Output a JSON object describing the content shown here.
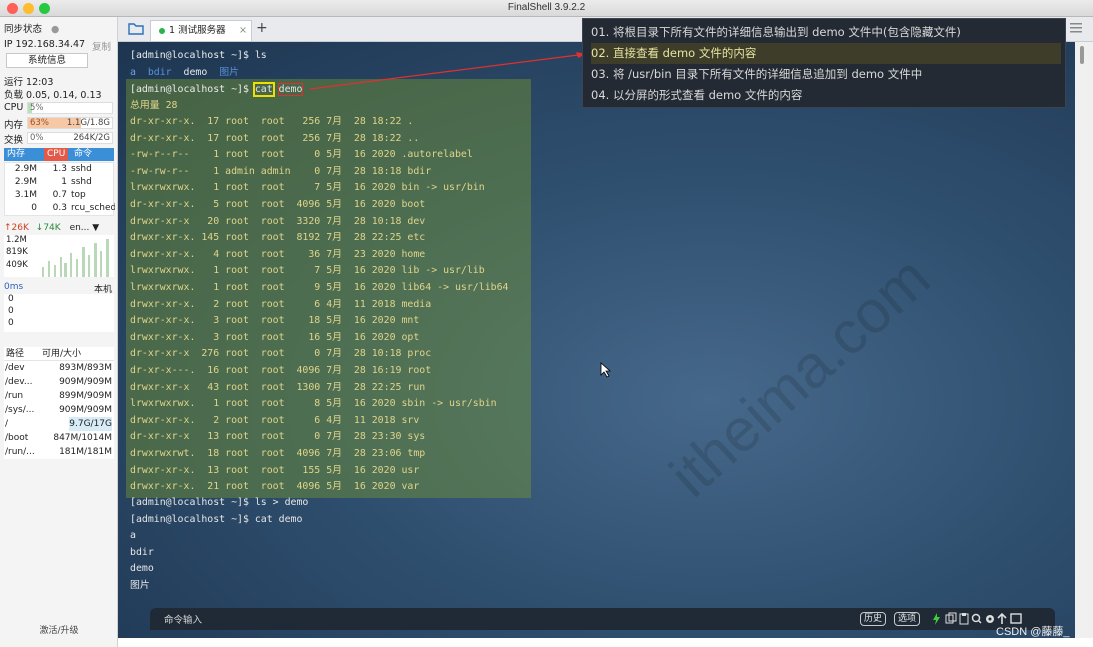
{
  "window": {
    "title": "FinalShell 3.9.2.2"
  },
  "sidebar": {
    "sync_status": "同步状态",
    "ip": "IP 192.168.34.47",
    "copy": "复制",
    "sysinfo_button": "系统信息",
    "uptime": "运行 12:03",
    "load": "负载 0.05, 0.14, 0.13",
    "cpu": {
      "label": "CPU",
      "value": "5%",
      "fraction": 0.05
    },
    "mem": {
      "label": "内存",
      "percent": "63%",
      "value": "1.1G/1.8G",
      "fraction": 0.63
    },
    "swap": {
      "label": "交换",
      "percent": "0%",
      "value": "264K/2G",
      "fraction": 0.0
    },
    "proc_headers": [
      "内存",
      "CPU",
      "命令"
    ],
    "processes": [
      {
        "mem": "2.9M",
        "cpu": "1.3",
        "cmd": "sshd"
      },
      {
        "mem": "2.9M",
        "cpu": "1",
        "cmd": "sshd"
      },
      {
        "mem": "3.1M",
        "cpu": "0.7",
        "cmd": "top"
      },
      {
        "mem": "0",
        "cpu": "0.3",
        "cmd": "rcu_sched"
      }
    ],
    "net": {
      "up": "↑26K",
      "down": "↓74K",
      "iface": "en...",
      "scale": [
        "1.2M",
        "819K",
        "409K"
      ]
    },
    "latency": {
      "value": "0ms",
      "host": "本机",
      "scale": [
        "0",
        "0",
        "0"
      ]
    },
    "disk_headers": [
      "路径",
      "可用/大小"
    ],
    "disks": [
      {
        "path": "/dev",
        "size": "893M/893M"
      },
      {
        "path": "/dev...",
        "size": "909M/909M"
      },
      {
        "path": "/run",
        "size": "899M/909M"
      },
      {
        "path": "/sys/...",
        "size": "909M/909M"
      },
      {
        "path": "/",
        "size": "9.7G/17G"
      },
      {
        "path": "/boot",
        "size": "847M/1014M"
      },
      {
        "path": "/run/...",
        "size": "181M/181M"
      }
    ],
    "upgrade": "激活/升级"
  },
  "tabs": [
    {
      "label": "1 测试服务器",
      "close": "×"
    }
  ],
  "tab_add": "+",
  "terminal": {
    "prompt1": "[admin@localhost ~]$ ",
    "cmd1": "ls",
    "ls_items": [
      "a",
      "bdir",
      "demo",
      "图片"
    ],
    "prompt2": "[admin@localhost ~]$ ",
    "cmd2_word": "cat",
    "cmd2_arg": "demo",
    "total": "总用量 28",
    "listing": [
      "dr-xr-xr-x.  17 root  root   256 7月  28 18:22 .",
      "dr-xr-xr-x.  17 root  root   256 7月  28 18:22 ..",
      "-rw-r--r--    1 root  root     0 5月  16 2020 .autorelabel",
      "-rw-rw-r--    1 admin admin    0 7月  28 18:18 bdir",
      "lrwxrwxrwx.   1 root  root     7 5月  16 2020 bin -> usr/bin",
      "dr-xr-xr-x.   5 root  root  4096 5月  16 2020 boot",
      "drwxr-xr-x   20 root  root  3320 7月  28 10:18 dev",
      "drwxr-xr-x. 145 root  root  8192 7月  28 22:25 etc",
      "drwxr-xr-x.   4 root  root    36 7月  23 2020 home",
      "lrwxrwxrwx.   1 root  root     7 5月  16 2020 lib -> usr/lib",
      "lrwxrwxrwx.   1 root  root     9 5月  16 2020 lib64 -> usr/lib64",
      "drwxr-xr-x.   2 root  root     6 4月  11 2018 media",
      "drwxr-xr-x.   3 root  root    18 5月  16 2020 mnt",
      "drwxr-xr-x.   3 root  root    16 5月  16 2020 opt",
      "dr-xr-xr-x  276 root  root     0 7月  28 10:18 proc",
      "dr-xr-x---.  16 root  root  4096 7月  28 16:19 root",
      "drwxr-xr-x   43 root  root  1300 7月  28 22:25 run",
      "lrwxrwxrwx.   1 root  root     8 5月  16 2020 sbin -> usr/sbin",
      "drwxr-xr-x.   2 root  root     6 4月  11 2018 srv",
      "dr-xr-xr-x   13 root  root     0 7月  28 23:30 sys",
      "drwxrwxrwt.  18 root  root  4096 7月  28 23:06 tmp",
      "drwxr-xr-x.  13 root  root   155 5月  16 2020 usr",
      "drwxr-xr-x.  21 root  root  4096 5月  16 2020 var"
    ],
    "line_ls_redirect": "[admin@localhost ~]$ ls > demo",
    "line_cat_demo": "[admin@localhost ~]$ cat demo",
    "output": [
      "a",
      "bdir",
      "demo",
      "图片"
    ]
  },
  "notes": [
    "01. 将根目录下所有文件的详细信息输出到 demo 文件中(包含隐藏文件)",
    "02. 直接查看 demo 文件的内容",
    "03. 将 /usr/bin 目录下所有文件的详细信息追加到 demo 文件中",
    "04. 以分屏的形式查看 demo 文件的内容"
  ],
  "cmdbar": {
    "label": "命令输入",
    "history": "历史",
    "options": "选项"
  },
  "credit": "CSDN @藤藤_",
  "colors": {
    "accent": "#3b8fd7",
    "terminal_bg": "#2f4f6f",
    "highlight_box": "#f0e000",
    "annotation": "#e03030"
  }
}
